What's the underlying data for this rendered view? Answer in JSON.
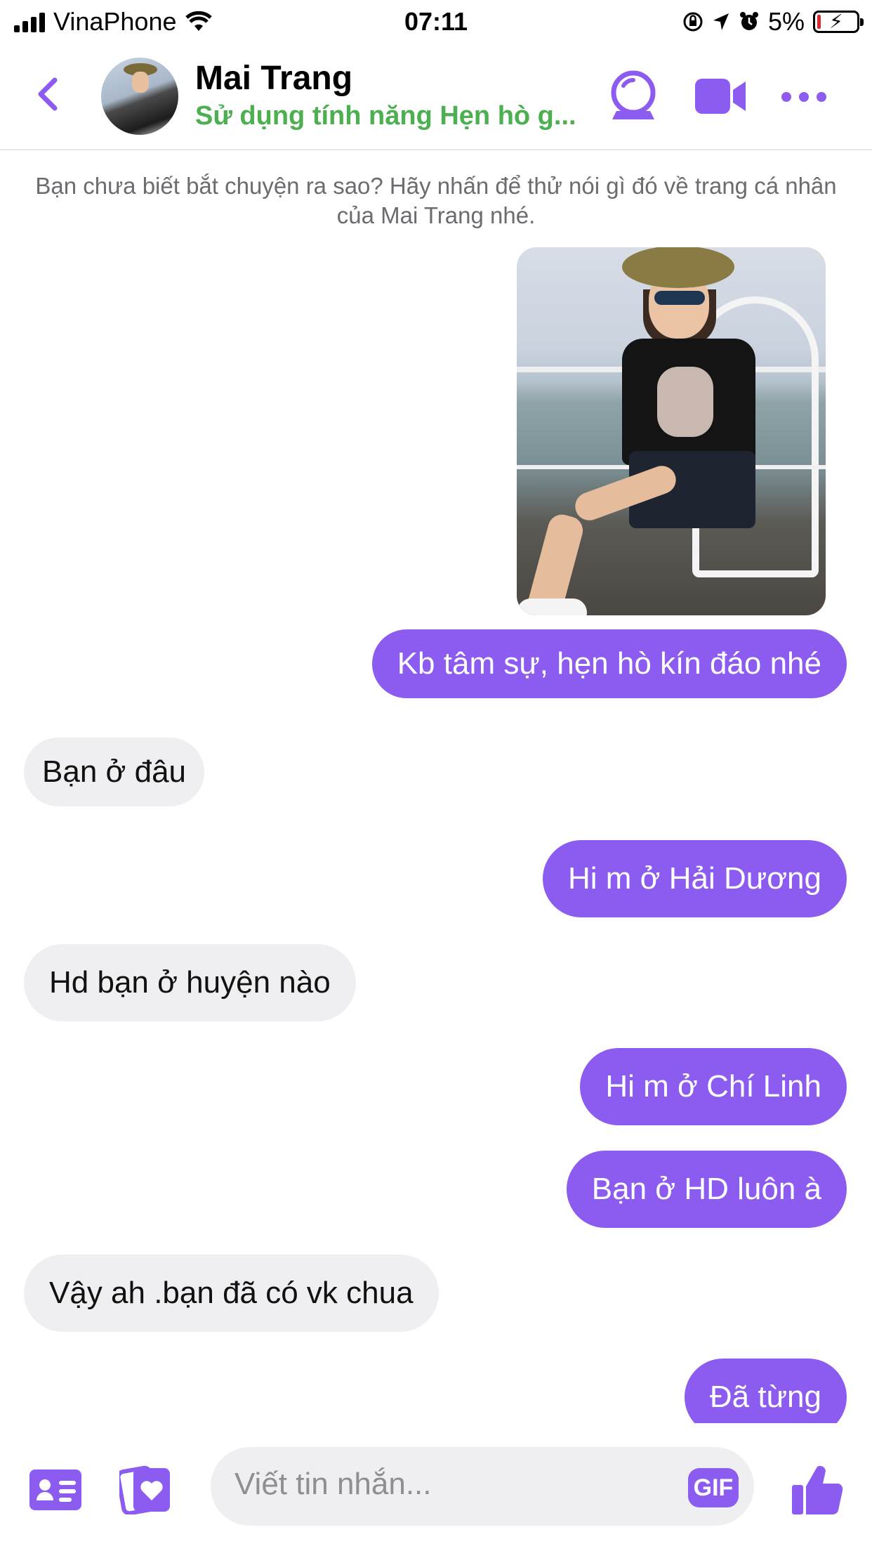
{
  "status_bar": {
    "carrier": "VinaPhone",
    "time": "07:11",
    "battery": "5%"
  },
  "header": {
    "name": "Mai Trang",
    "subtitle": "Sử dụng tính năng Hẹn hò g..."
  },
  "chat": {
    "hint": "Bạn chưa biết bắt chuyện ra sao? Hãy nhấn để thử nói gì đó về trang cá nhân của Mai Trang nhé.",
    "messages": [
      {
        "from": "me",
        "text": "Kb tâm sự, hẹn hò kín đáo nhé"
      },
      {
        "from": "them",
        "text": "Bạn ở đâu"
      },
      {
        "from": "me",
        "text": "Hi m ở Hải Dương"
      },
      {
        "from": "them",
        "text": "Hd bạn ở huyện nào"
      },
      {
        "from": "me",
        "text": "Hi m ở Chí Linh"
      },
      {
        "from": "me",
        "text": "Bạn ở HD luôn à"
      },
      {
        "from": "them",
        "text": "Vậy ah .bạn đã có vk chua"
      },
      {
        "from": "me",
        "text": "Đã từng"
      }
    ]
  },
  "composer": {
    "placeholder": "Viết tin nhắn...",
    "gif_label": "GIF"
  },
  "colors": {
    "accent": "#8c5cf0",
    "subtitle_green": "#4caf50",
    "incoming_bubble": "#efeff2"
  },
  "icons": [
    "back-chevron-icon",
    "dating-globe-icon",
    "video-call-icon",
    "more-icon",
    "contact-card-icon",
    "photos-heart-icon",
    "gif-icon",
    "like-thumb-icon"
  ]
}
